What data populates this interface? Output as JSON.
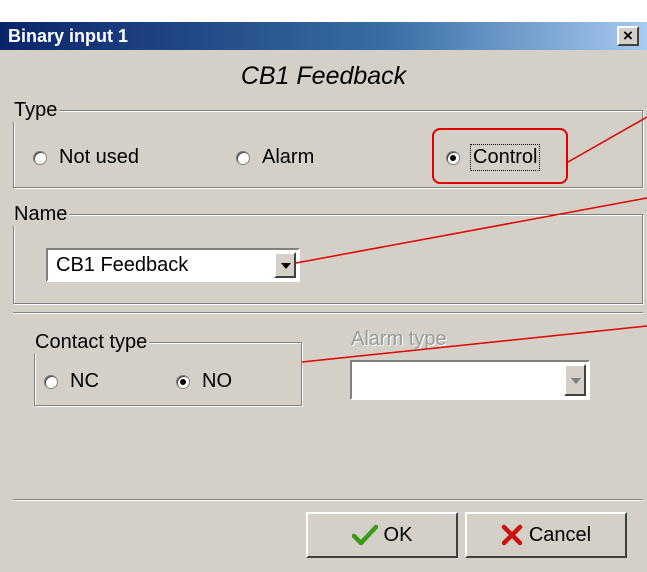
{
  "window": {
    "title": "Binary input 1",
    "close_label": "×"
  },
  "heading": "CB1 Feedback",
  "type_group": {
    "label": "Type",
    "options": [
      {
        "label": "Not used",
        "checked": false
      },
      {
        "label": "Alarm",
        "checked": false
      },
      {
        "label": "Control",
        "checked": true
      }
    ]
  },
  "name_group": {
    "label": "Name",
    "selected": "CB1 Feedback"
  },
  "contact_group": {
    "label": "Contact type",
    "options": [
      {
        "label": "NC",
        "checked": false
      },
      {
        "label": "NO",
        "checked": true
      }
    ]
  },
  "alarm_type": {
    "label": "Alarm type",
    "value": "",
    "enabled": false
  },
  "buttons": {
    "ok": "OK",
    "cancel": "Cancel"
  },
  "icons": {
    "ok": "checkmark-icon",
    "cancel": "x-icon",
    "close": "close-icon",
    "dropdown": "chevron-down-icon"
  },
  "colors": {
    "titlebar": "#0a246a",
    "annotation": "#e00000",
    "ok_icon": "#3a9a1a",
    "cancel_icon": "#cc1111"
  }
}
